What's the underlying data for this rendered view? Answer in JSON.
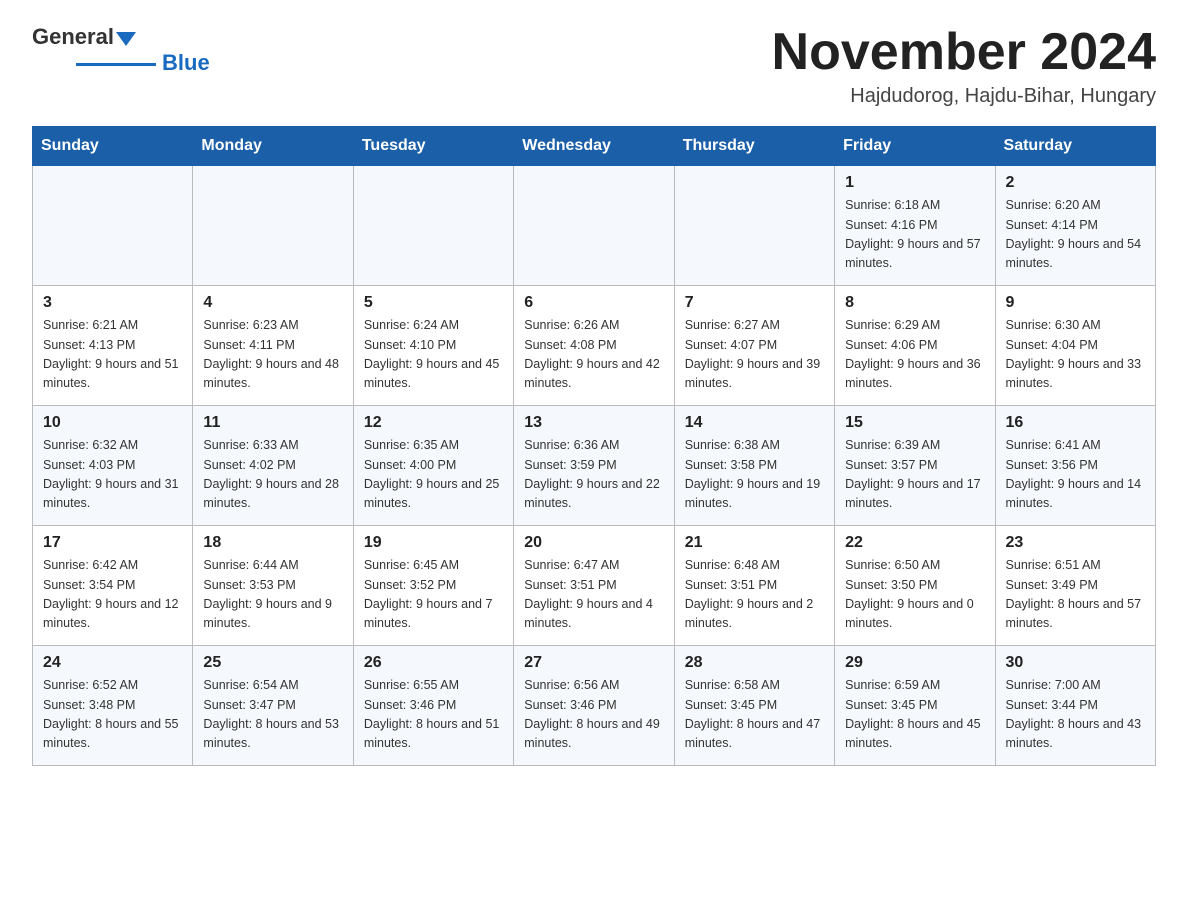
{
  "header": {
    "logo_general": "General",
    "logo_blue": "Blue",
    "month_title": "November 2024",
    "location": "Hajdudorog, Hajdu-Bihar, Hungary"
  },
  "weekdays": [
    "Sunday",
    "Monday",
    "Tuesday",
    "Wednesday",
    "Thursday",
    "Friday",
    "Saturday"
  ],
  "weeks": [
    [
      {
        "day": "",
        "info": ""
      },
      {
        "day": "",
        "info": ""
      },
      {
        "day": "",
        "info": ""
      },
      {
        "day": "",
        "info": ""
      },
      {
        "day": "",
        "info": ""
      },
      {
        "day": "1",
        "info": "Sunrise: 6:18 AM\nSunset: 4:16 PM\nDaylight: 9 hours\nand 57 minutes."
      },
      {
        "day": "2",
        "info": "Sunrise: 6:20 AM\nSunset: 4:14 PM\nDaylight: 9 hours\nand 54 minutes."
      }
    ],
    [
      {
        "day": "3",
        "info": "Sunrise: 6:21 AM\nSunset: 4:13 PM\nDaylight: 9 hours\nand 51 minutes."
      },
      {
        "day": "4",
        "info": "Sunrise: 6:23 AM\nSunset: 4:11 PM\nDaylight: 9 hours\nand 48 minutes."
      },
      {
        "day": "5",
        "info": "Sunrise: 6:24 AM\nSunset: 4:10 PM\nDaylight: 9 hours\nand 45 minutes."
      },
      {
        "day": "6",
        "info": "Sunrise: 6:26 AM\nSunset: 4:08 PM\nDaylight: 9 hours\nand 42 minutes."
      },
      {
        "day": "7",
        "info": "Sunrise: 6:27 AM\nSunset: 4:07 PM\nDaylight: 9 hours\nand 39 minutes."
      },
      {
        "day": "8",
        "info": "Sunrise: 6:29 AM\nSunset: 4:06 PM\nDaylight: 9 hours\nand 36 minutes."
      },
      {
        "day": "9",
        "info": "Sunrise: 6:30 AM\nSunset: 4:04 PM\nDaylight: 9 hours\nand 33 minutes."
      }
    ],
    [
      {
        "day": "10",
        "info": "Sunrise: 6:32 AM\nSunset: 4:03 PM\nDaylight: 9 hours\nand 31 minutes."
      },
      {
        "day": "11",
        "info": "Sunrise: 6:33 AM\nSunset: 4:02 PM\nDaylight: 9 hours\nand 28 minutes."
      },
      {
        "day": "12",
        "info": "Sunrise: 6:35 AM\nSunset: 4:00 PM\nDaylight: 9 hours\nand 25 minutes."
      },
      {
        "day": "13",
        "info": "Sunrise: 6:36 AM\nSunset: 3:59 PM\nDaylight: 9 hours\nand 22 minutes."
      },
      {
        "day": "14",
        "info": "Sunrise: 6:38 AM\nSunset: 3:58 PM\nDaylight: 9 hours\nand 19 minutes."
      },
      {
        "day": "15",
        "info": "Sunrise: 6:39 AM\nSunset: 3:57 PM\nDaylight: 9 hours\nand 17 minutes."
      },
      {
        "day": "16",
        "info": "Sunrise: 6:41 AM\nSunset: 3:56 PM\nDaylight: 9 hours\nand 14 minutes."
      }
    ],
    [
      {
        "day": "17",
        "info": "Sunrise: 6:42 AM\nSunset: 3:54 PM\nDaylight: 9 hours\nand 12 minutes."
      },
      {
        "day": "18",
        "info": "Sunrise: 6:44 AM\nSunset: 3:53 PM\nDaylight: 9 hours\nand 9 minutes."
      },
      {
        "day": "19",
        "info": "Sunrise: 6:45 AM\nSunset: 3:52 PM\nDaylight: 9 hours\nand 7 minutes."
      },
      {
        "day": "20",
        "info": "Sunrise: 6:47 AM\nSunset: 3:51 PM\nDaylight: 9 hours\nand 4 minutes."
      },
      {
        "day": "21",
        "info": "Sunrise: 6:48 AM\nSunset: 3:51 PM\nDaylight: 9 hours\nand 2 minutes."
      },
      {
        "day": "22",
        "info": "Sunrise: 6:50 AM\nSunset: 3:50 PM\nDaylight: 9 hours\nand 0 minutes."
      },
      {
        "day": "23",
        "info": "Sunrise: 6:51 AM\nSunset: 3:49 PM\nDaylight: 8 hours\nand 57 minutes."
      }
    ],
    [
      {
        "day": "24",
        "info": "Sunrise: 6:52 AM\nSunset: 3:48 PM\nDaylight: 8 hours\nand 55 minutes."
      },
      {
        "day": "25",
        "info": "Sunrise: 6:54 AM\nSunset: 3:47 PM\nDaylight: 8 hours\nand 53 minutes."
      },
      {
        "day": "26",
        "info": "Sunrise: 6:55 AM\nSunset: 3:46 PM\nDaylight: 8 hours\nand 51 minutes."
      },
      {
        "day": "27",
        "info": "Sunrise: 6:56 AM\nSunset: 3:46 PM\nDaylight: 8 hours\nand 49 minutes."
      },
      {
        "day": "28",
        "info": "Sunrise: 6:58 AM\nSunset: 3:45 PM\nDaylight: 8 hours\nand 47 minutes."
      },
      {
        "day": "29",
        "info": "Sunrise: 6:59 AM\nSunset: 3:45 PM\nDaylight: 8 hours\nand 45 minutes."
      },
      {
        "day": "30",
        "info": "Sunrise: 7:00 AM\nSunset: 3:44 PM\nDaylight: 8 hours\nand 43 minutes."
      }
    ]
  ]
}
